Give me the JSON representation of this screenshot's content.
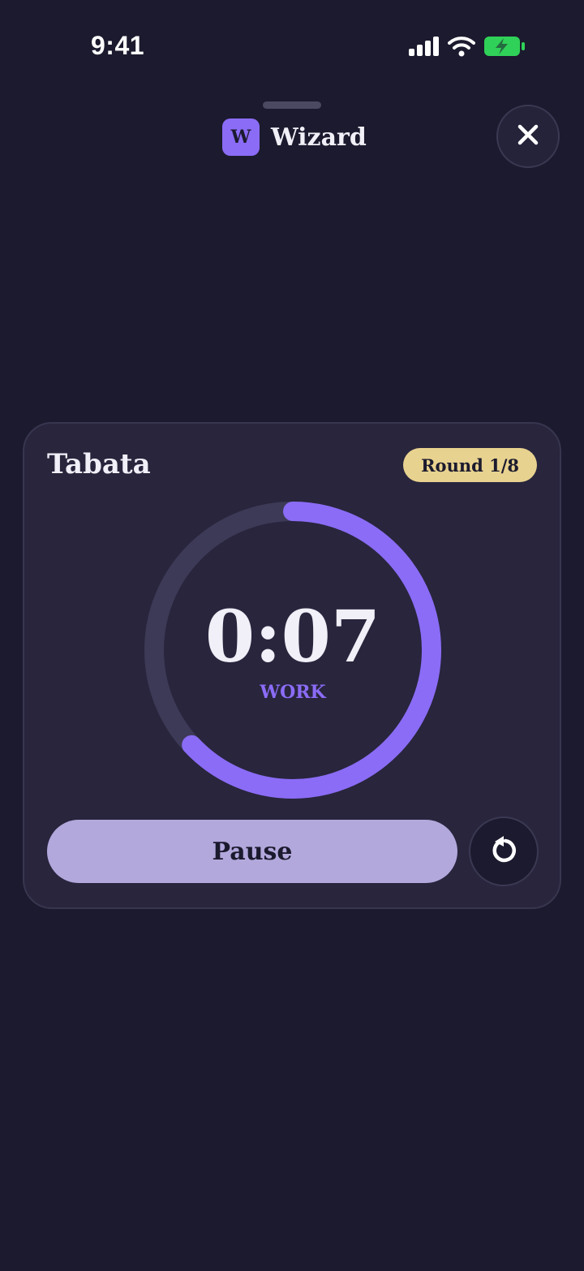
{
  "status_bar": {
    "time": "9:41",
    "icons": [
      "cellular-signal-icon",
      "wifi-icon",
      "battery-charging-icon"
    ]
  },
  "header": {
    "logo_letter": "W",
    "title": "Wizard",
    "close_icon": "close-icon"
  },
  "timer_card": {
    "title": "Tabata",
    "round_label": "Round 1/8",
    "time_remaining": "0:07",
    "phase": "WORK",
    "progress_fraction": 0.63,
    "pause_label": "Pause",
    "reset_icon": "restart-icon"
  },
  "colors": {
    "background": "#1b1a2e",
    "card": "#28253d",
    "accent": "#8b6cf6",
    "ring_track": "#3d3a57",
    "badge": "#e8d28f",
    "button": "#b3a8dc",
    "battery": "#30d158"
  }
}
